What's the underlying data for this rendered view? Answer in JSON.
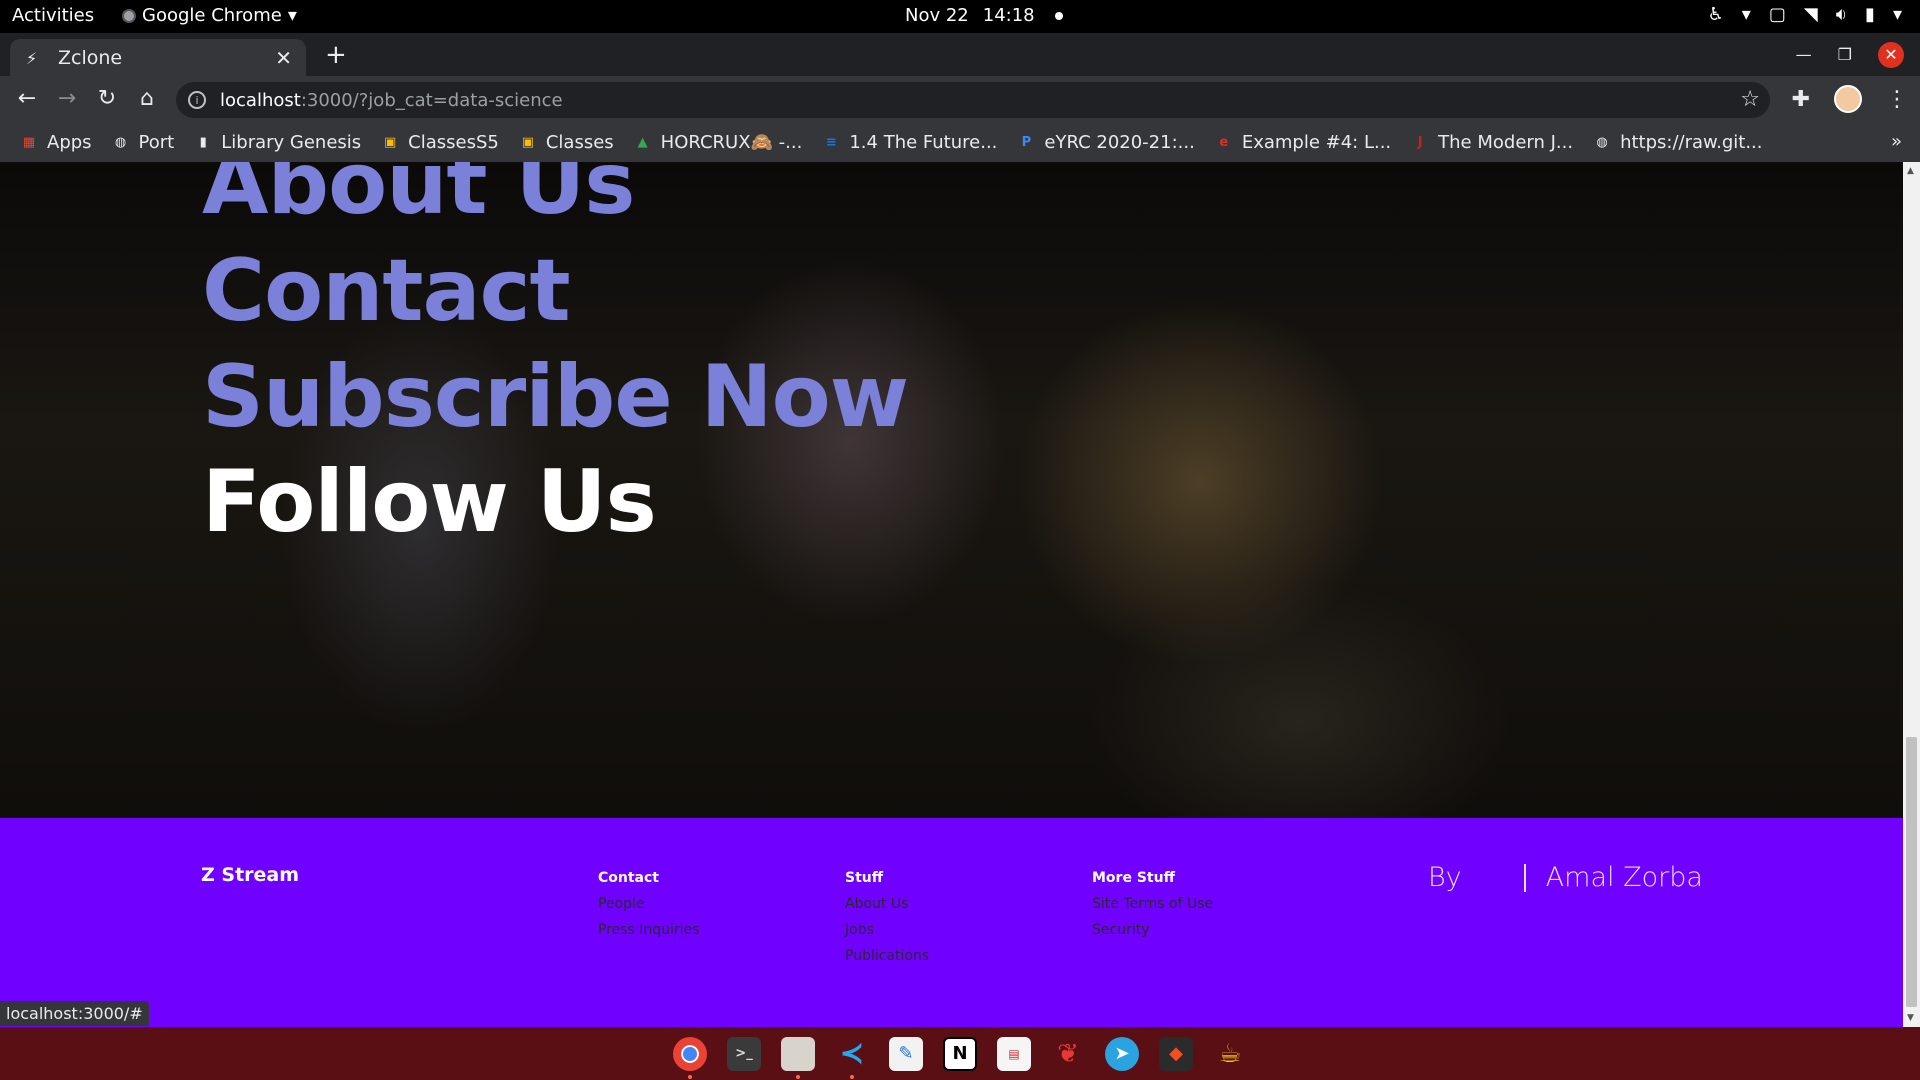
{
  "system": {
    "activities": "Activities",
    "app_name": "Google Chrome",
    "date": "Nov 22",
    "time": "14:18"
  },
  "browser": {
    "tab_title": "Zclone",
    "url_host": "localhost",
    "url_path": ":3000/?job_cat=data-science",
    "status_url": "localhost:3000/#"
  },
  "bookmarks": [
    {
      "label": "Apps",
      "icon": "apps-grid-icon",
      "color": "#ea4335"
    },
    {
      "label": "Port",
      "icon": "globe-icon",
      "color": "#e8eaed"
    },
    {
      "label": "Library Genesis",
      "icon": "book-icon",
      "color": "#e8eaed"
    },
    {
      "label": "ClassesS5",
      "icon": "classroom-icon",
      "color": "#fbbc04"
    },
    {
      "label": "Classes",
      "icon": "classroom-icon",
      "color": "#fbbc04"
    },
    {
      "label": "HORCRUX🙈 -...",
      "icon": "drive-icon",
      "color": "#34a853"
    },
    {
      "label": "1.4 The Future...",
      "icon": "ieee-icon",
      "color": "#1a73e8"
    },
    {
      "label": "eYRC 2020-21:...",
      "icon": "p-icon",
      "color": "#4285f4"
    },
    {
      "label": "Example #4: L...",
      "icon": "e-icon",
      "color": "#d93025"
    },
    {
      "label": "The Modern J...",
      "icon": "js-icon",
      "color": "#c5221f"
    },
    {
      "label": "https://raw.git...",
      "icon": "globe-icon",
      "color": "#e8eaed"
    }
  ],
  "hero": {
    "links": [
      "About Us",
      "Contact",
      "Subscribe Now",
      "Follow Us"
    ]
  },
  "footer": {
    "brand": "Z Stream",
    "columns": [
      {
        "heading": "Contact",
        "links": [
          "People",
          "Press Inquiries"
        ]
      },
      {
        "heading": "Stuff",
        "links": [
          "About Us",
          "Jobs",
          "Publications"
        ]
      },
      {
        "heading": "More Stuff",
        "links": [
          "Site Terms of Use",
          "Security"
        ]
      }
    ],
    "by": "By",
    "author": "Amal Zorba"
  },
  "colors": {
    "link_accent": "#7b80d8",
    "footer_bg": "#7000ff",
    "dock_bg": "#5a0f15"
  },
  "dock": [
    "chrome-icon",
    "terminal-icon",
    "files-icon",
    "vscode-icon",
    "text-editor-icon",
    "notion-icon",
    "document-viewer-icon",
    "cherry-icon",
    "telegram-icon",
    "figma-icon",
    "teapot-icon"
  ]
}
